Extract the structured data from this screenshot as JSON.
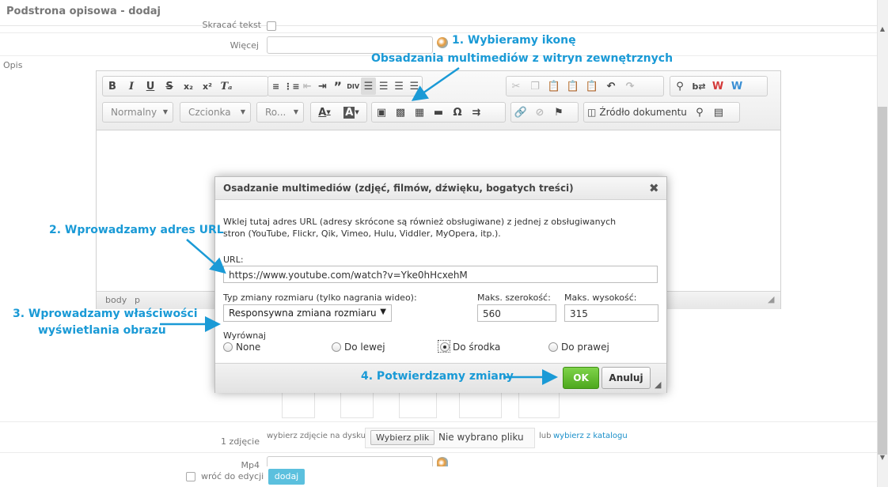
{
  "page": {
    "title": "Podstrona opisowa - dodaj"
  },
  "form": {
    "shorten_label": "Skracać tekst",
    "more_label": "Więcej",
    "description_label": "Opis",
    "photo_label": "1 zdjęcie",
    "photo_choose_text": "wybierz zdjęcie na dysku",
    "photo_file_button": "Wybierz plik",
    "photo_no_file": "Nie wybrano pliku",
    "photo_or": "lub",
    "photo_catalog_link": "wybierz z katalogu",
    "mp4_label": "Mp4",
    "return_label": "wróć do edycji",
    "submit_label": "dodaj"
  },
  "editor": {
    "combos": {
      "format": "Normalny",
      "font": "Czcionka",
      "size": "Ro..."
    },
    "source_label": "Źródło dokumentu",
    "path": [
      "body",
      "p"
    ]
  },
  "dialog": {
    "title": "Osadzanie multimediów (zdjęć, filmów, dźwięku, bogatych treści)",
    "description_line1": "Wklej tutaj adres URL (adresy skrócone są również obsługiwane) z jednej z obsługiwanych",
    "description_line2": "stron (YouTube, Flickr, Qik, Vimeo, Hulu, Viddler, MyOpera, itp.).",
    "url_label": "URL:",
    "url_value": "https://www.youtube.com/watch?v=Yke0hHcxehM",
    "resize_label": "Typ zmiany rozmiaru (tylko nagrania wideo):",
    "resize_value": "Responsywna zmiana rozmiaru",
    "max_width_label": "Maks. szerokość:",
    "max_width_value": "560",
    "max_height_label": "Maks. wysokość:",
    "max_height_value": "315",
    "align_label": "Wyrównaj",
    "align_options": [
      "None",
      "Do lewej",
      "Do środka",
      "Do prawej"
    ],
    "align_selected": "Do środka",
    "ok_label": "OK",
    "cancel_label": "Anuluj"
  },
  "annotations": {
    "step1_line1": "1. Wybieramy ikonę",
    "step1_line2": "Obsadzania multimediów z witryn zewnętrznych",
    "step2": "2. Wprowadzamy adres URL",
    "step3_line1": "3. Wprowadzamy właściwości",
    "step3_line2": "wyświetlania obrazu",
    "step4": "4. Potwierdzamy zmiany"
  },
  "colors": {
    "annotation": "#1a9ad6",
    "ok_button": "#5cb82a",
    "submit_button": "#5bc0de"
  }
}
